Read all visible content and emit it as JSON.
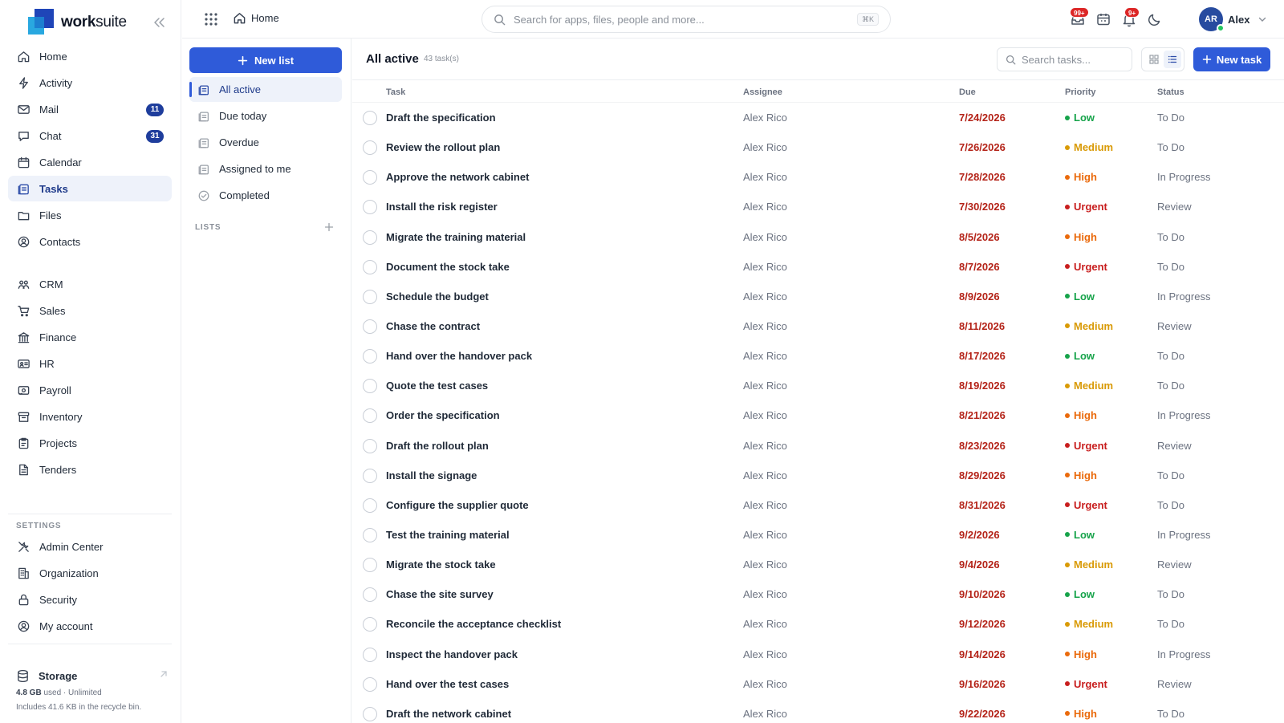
{
  "brand": {
    "name_bold": "work",
    "name_light": "suite"
  },
  "colors": {
    "primary": "#2f5bd9",
    "nav_active_bg": "#eef2fa",
    "badge": "#1e3d9c",
    "due": "#b42318",
    "low": "#16a34a",
    "medium": "#d99a06",
    "high": "#ea6a0c",
    "urgent": "#c81e1e"
  },
  "nav": [
    {
      "label": "Home",
      "icon": "home-icon"
    },
    {
      "label": "Activity",
      "icon": "activity-icon"
    },
    {
      "label": "Mail",
      "icon": "mail-icon",
      "badge": "11"
    },
    {
      "label": "Chat",
      "icon": "chat-icon",
      "badge": "31"
    },
    {
      "label": "Calendar",
      "icon": "calendar-icon"
    },
    {
      "label": "Tasks",
      "icon": "tasks-icon",
      "active": true
    },
    {
      "label": "Files",
      "icon": "folder-icon"
    },
    {
      "label": "Contacts",
      "icon": "contacts-icon"
    },
    {
      "label": "CRM",
      "icon": "crm-icon"
    },
    {
      "label": "Sales",
      "icon": "cart-icon"
    },
    {
      "label": "Finance",
      "icon": "bank-icon"
    },
    {
      "label": "HR",
      "icon": "id-card-icon"
    },
    {
      "label": "Payroll",
      "icon": "payroll-icon"
    },
    {
      "label": "Inventory",
      "icon": "archive-icon"
    },
    {
      "label": "Projects",
      "icon": "projects-icon"
    },
    {
      "label": "Tenders",
      "icon": "document-icon"
    }
  ],
  "settings": {
    "label": "SETTINGS",
    "items": [
      {
        "label": "Admin Center",
        "icon": "tools-icon"
      },
      {
        "label": "Organization",
        "icon": "building-icon"
      },
      {
        "label": "Security",
        "icon": "lock-icon"
      },
      {
        "label": "My account",
        "icon": "user-circle-icon"
      }
    ]
  },
  "storage": {
    "title": "Storage",
    "used": "4.8 GB",
    "used_suffix": "used · Unlimited",
    "note": "Includes 41.6 KB in the recycle bin."
  },
  "topbar": {
    "breadcrumb": "Home",
    "search_placeholder": "Search for apps, files, people and more...",
    "shortcut": "⌘K",
    "notifications_badge": "99+",
    "alerts_badge": "9+",
    "user_initials": "AR",
    "user_name": "Alex"
  },
  "lists_panel": {
    "new_list_label": "New list",
    "items": [
      {
        "label": "All active",
        "icon": "list-icon",
        "active": true
      },
      {
        "label": "Due today",
        "icon": "list-icon"
      },
      {
        "label": "Overdue",
        "icon": "list-icon"
      },
      {
        "label": "Assigned to me",
        "icon": "list-icon"
      },
      {
        "label": "Completed",
        "icon": "check-circle-icon"
      }
    ],
    "lists_label": "LISTS"
  },
  "main": {
    "title": "All active",
    "count": "43 task(s)",
    "search_placeholder": "Search tasks...",
    "new_task_label": "New task",
    "columns": {
      "task": "Task",
      "assignee": "Assignee",
      "due": "Due",
      "priority": "Priority",
      "status": "Status"
    },
    "rows": [
      {
        "task": "Draft the specification",
        "assignee": "Alex Rico",
        "due": "7/24/2026",
        "priority": "Low",
        "status": "To Do"
      },
      {
        "task": "Review the rollout plan",
        "assignee": "Alex Rico",
        "due": "7/26/2026",
        "priority": "Medium",
        "status": "To Do"
      },
      {
        "task": "Approve the network cabinet",
        "assignee": "Alex Rico",
        "due": "7/28/2026",
        "priority": "High",
        "status": "In Progress"
      },
      {
        "task": "Install the risk register",
        "assignee": "Alex Rico",
        "due": "7/30/2026",
        "priority": "Urgent",
        "status": "Review"
      },
      {
        "task": "Migrate the training material",
        "assignee": "Alex Rico",
        "due": "8/5/2026",
        "priority": "High",
        "status": "To Do"
      },
      {
        "task": "Document the stock take",
        "assignee": "Alex Rico",
        "due": "8/7/2026",
        "priority": "Urgent",
        "status": "To Do"
      },
      {
        "task": "Schedule the budget",
        "assignee": "Alex Rico",
        "due": "8/9/2026",
        "priority": "Low",
        "status": "In Progress"
      },
      {
        "task": "Chase the contract",
        "assignee": "Alex Rico",
        "due": "8/11/2026",
        "priority": "Medium",
        "status": "Review"
      },
      {
        "task": "Hand over the handover pack",
        "assignee": "Alex Rico",
        "due": "8/17/2026",
        "priority": "Low",
        "status": "To Do"
      },
      {
        "task": "Quote the test cases",
        "assignee": "Alex Rico",
        "due": "8/19/2026",
        "priority": "Medium",
        "status": "To Do"
      },
      {
        "task": "Order the specification",
        "assignee": "Alex Rico",
        "due": "8/21/2026",
        "priority": "High",
        "status": "In Progress"
      },
      {
        "task": "Draft the rollout plan",
        "assignee": "Alex Rico",
        "due": "8/23/2026",
        "priority": "Urgent",
        "status": "Review"
      },
      {
        "task": "Install the signage",
        "assignee": "Alex Rico",
        "due": "8/29/2026",
        "priority": "High",
        "status": "To Do"
      },
      {
        "task": "Configure the supplier quote",
        "assignee": "Alex Rico",
        "due": "8/31/2026",
        "priority": "Urgent",
        "status": "To Do"
      },
      {
        "task": "Test the training material",
        "assignee": "Alex Rico",
        "due": "9/2/2026",
        "priority": "Low",
        "status": "In Progress"
      },
      {
        "task": "Migrate the stock take",
        "assignee": "Alex Rico",
        "due": "9/4/2026",
        "priority": "Medium",
        "status": "Review"
      },
      {
        "task": "Chase the site survey",
        "assignee": "Alex Rico",
        "due": "9/10/2026",
        "priority": "Low",
        "status": "To Do"
      },
      {
        "task": "Reconcile the acceptance checklist",
        "assignee": "Alex Rico",
        "due": "9/12/2026",
        "priority": "Medium",
        "status": "To Do"
      },
      {
        "task": "Inspect the handover pack",
        "assignee": "Alex Rico",
        "due": "9/14/2026",
        "priority": "High",
        "status": "In Progress"
      },
      {
        "task": "Hand over the test cases",
        "assignee": "Alex Rico",
        "due": "9/16/2026",
        "priority": "Urgent",
        "status": "Review"
      },
      {
        "task": "Draft the network cabinet",
        "assignee": "Alex Rico",
        "due": "9/22/2026",
        "priority": "High",
        "status": "To Do"
      }
    ]
  }
}
